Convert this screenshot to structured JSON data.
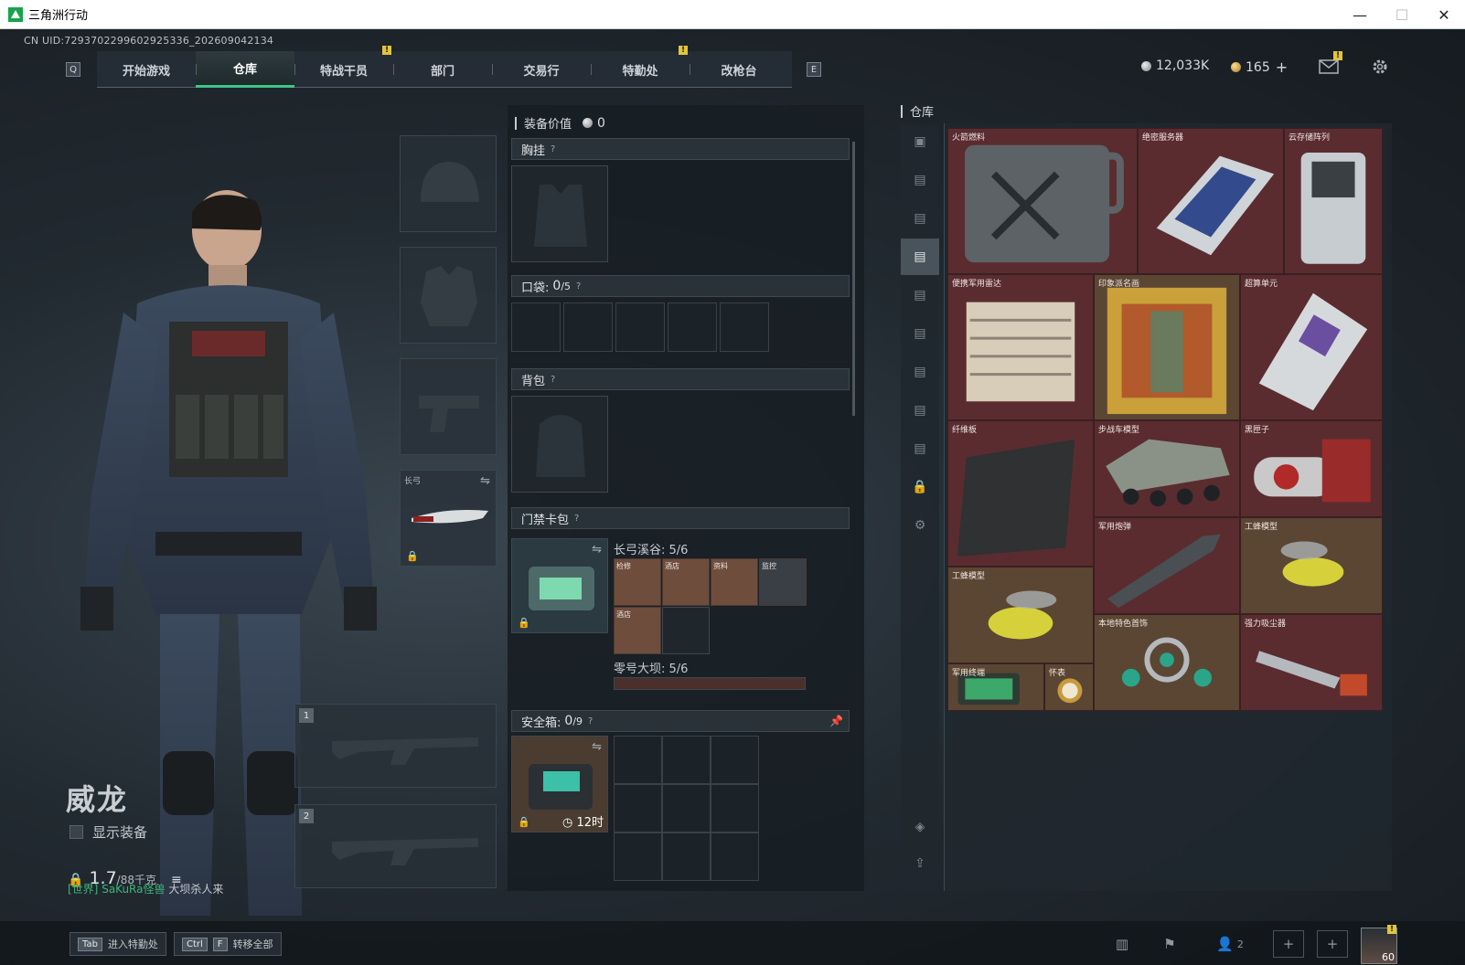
{
  "window": {
    "title": "三角洲行动",
    "minimize": "—",
    "maximize": "☐",
    "close": "✕"
  },
  "uid": "CN UID:7293702299602925336_202609042134",
  "nav": {
    "key_left": "Q",
    "key_right": "E",
    "tabs": [
      {
        "label": "开始游戏"
      },
      {
        "label": "仓库"
      },
      {
        "label": "特战干员"
      },
      {
        "label": "部门"
      },
      {
        "label": "交易行"
      },
      {
        "label": "特勤处"
      },
      {
        "label": "改枪台"
      }
    ],
    "badge": "!"
  },
  "currency": {
    "silver": "12,033K",
    "gold": "165",
    "plus": "+"
  },
  "character": {
    "name": "威龙",
    "show_equip": "显示装备",
    "weight_value": "1.7",
    "weight_max": "/88千克"
  },
  "chat": {
    "channel": "[世界]",
    "user": "SaKuRa怪兽",
    "message": "大坝杀人来"
  },
  "slots": {
    "melee_label": "长弓",
    "primary_num": "1",
    "secondary_num": "2"
  },
  "loadout": {
    "value_label": "装备价值",
    "value": "0",
    "chest": "胸挂",
    "pockets": "口袋:",
    "pockets_count": "0",
    "pockets_max": "/5",
    "backpack": "背包",
    "keycard_bag": "门禁卡包",
    "map1": "长弓溪谷: 5/6",
    "map2": "零号大坝: 5/6",
    "safe": "安全箱:",
    "safe_count": "0",
    "safe_max": "/9",
    "safe_timer": "12时",
    "help": "?",
    "keycards": [
      "检修",
      "酒店",
      "资料",
      "监控",
      "酒店"
    ]
  },
  "stash": {
    "title": "仓库",
    "items": [
      {
        "name": "火箭燃料"
      },
      {
        "name": "绝密服务器"
      },
      {
        "name": "云存储阵列"
      },
      {
        "name": "便携军用雷达"
      },
      {
        "name": "印象派名画"
      },
      {
        "name": "超算单元"
      },
      {
        "name": "纤维板"
      },
      {
        "name": "步战车模型"
      },
      {
        "name": "黑匣子"
      },
      {
        "name": "军用炮弹"
      },
      {
        "name": "工蜂模型"
      },
      {
        "name": "工蜂模型"
      },
      {
        "name": "本地特色首饰"
      },
      {
        "name": "强力吸尘器"
      },
      {
        "name": "军用终端"
      },
      {
        "name": "怀表"
      }
    ]
  },
  "bottom": {
    "tab_key": "Tab",
    "tab_hint": "进入特勤处",
    "ctrl_key": "Ctrl",
    "f_key": "F",
    "ctrl_hint": "转移全部",
    "friends_count": "2",
    "level": "60"
  },
  "colors": {
    "accent_green": "#3fc48a",
    "badge_yellow": "#e3c43a",
    "rare_red": "#5a2c2f"
  }
}
